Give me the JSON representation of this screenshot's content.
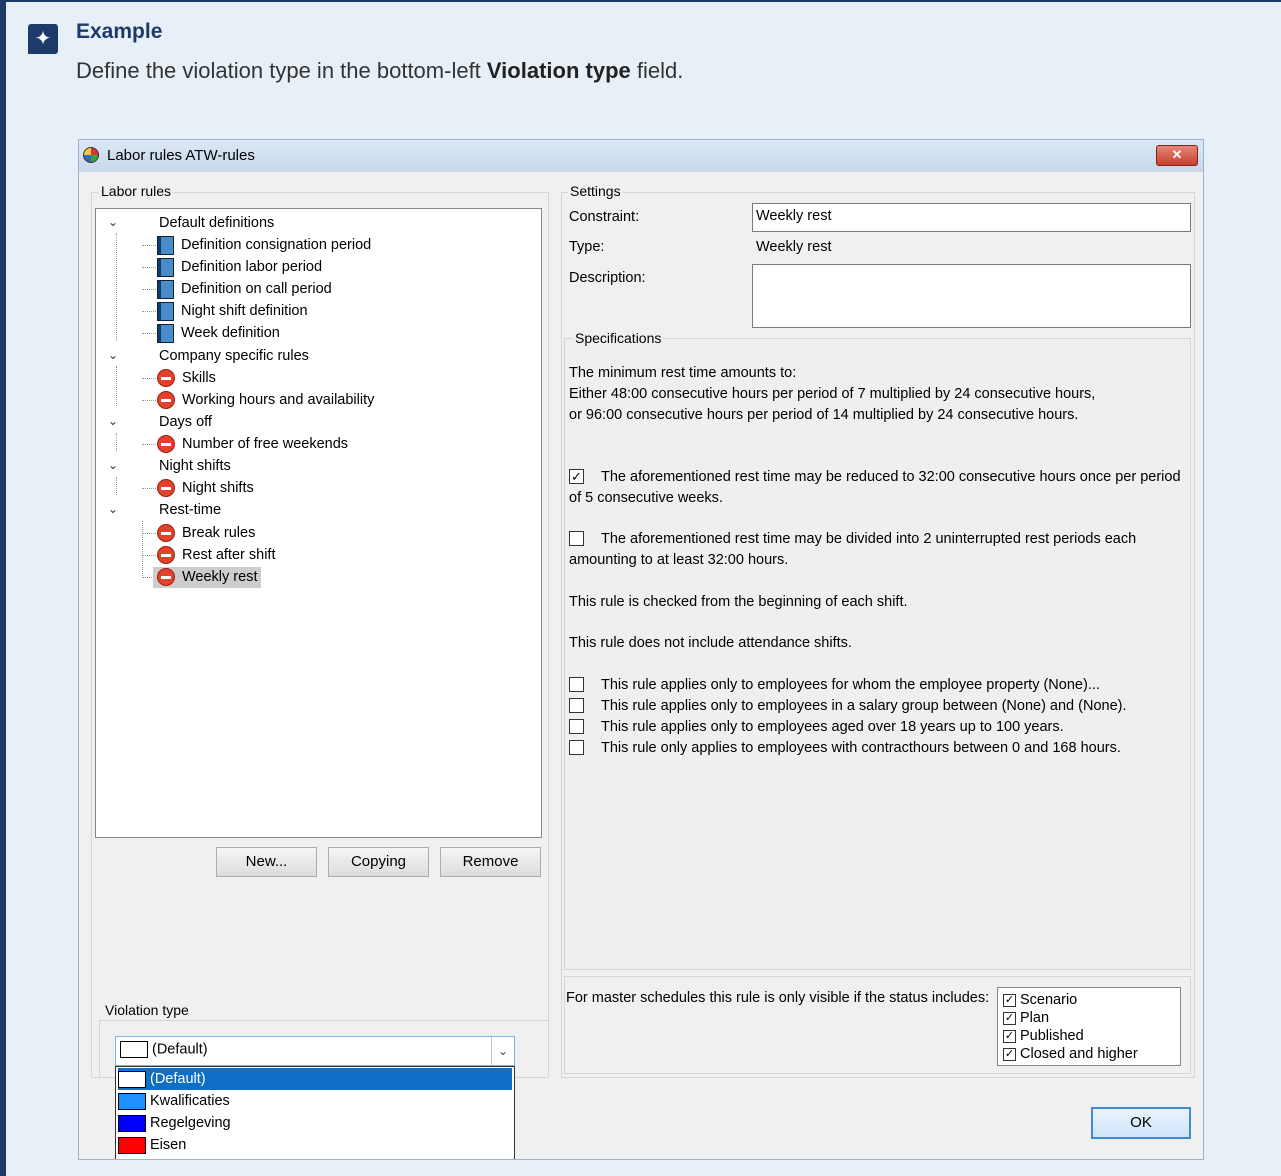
{
  "callout": {
    "icon": "sparkle-icon",
    "title": "Example",
    "body_prefix": "Define the violation type in the bottom-left ",
    "body_bold": "Violation type",
    "body_suffix": " field."
  },
  "dialog": {
    "title": "Labor rules ATW-rules",
    "close": "✕",
    "labor_rules_label": "Labor rules",
    "tree": {
      "group_default": "Default definitions",
      "default_items": [
        "Definition consignation period",
        "Definition labor period",
        "Definition on call period",
        "Night shift definition",
        "Week definition"
      ],
      "group_company": "Company specific rules",
      "company_items": [
        "Skills",
        "Working hours and availability"
      ],
      "group_daysoff": "Days off",
      "daysoff_items": [
        "Number of free weekends"
      ],
      "group_night": "Night shifts",
      "night_items": [
        "Night shifts"
      ],
      "group_rest": "Rest-time",
      "rest_items": [
        "Break rules",
        "Rest after shift",
        "Weekly rest"
      ]
    },
    "buttons": {
      "new": "New...",
      "copying": "Copying",
      "remove": "Remove",
      "ok": "OK"
    },
    "settings": {
      "label": "Settings",
      "constraint_label": "Constraint:",
      "constraint_value": "Weekly rest",
      "type_label": "Type:",
      "type_value": "Weekly rest",
      "description_label": "Description:",
      "description_value": ""
    },
    "specifications": {
      "label": "Specifications",
      "line1": "The minimum rest time amounts to:",
      "line2": "Either 48:00 consecutive hours per period of 7 multiplied by 24 consecutive hours,",
      "line3": "or 96:00 consecutive hours per period of 14 multiplied by 24 consecutive hours.",
      "reduce_a": "The aforementioned rest time may be reduced to 32:00 consecutive hours once per period",
      "reduce_b": "of 5 consecutive weeks.",
      "divide_a": "The aforementioned rest time may be divided into 2 uninterrupted rest periods each",
      "divide_b": "amounting to at least 32:00 hours.",
      "checked_from": "This rule is checked from the beginning of each shift.",
      "attendance": "This rule does not include attendance shifts.",
      "applies1": "This rule applies only to employees for whom the employee property (None)...",
      "applies2": "This rule applies only to employees in a salary group between (None) and (None).",
      "applies3": "This rule applies only to employees aged over 18 years up to 100 years.",
      "applies4": "This rule only applies to employees with contracthours between 0 and 168 hours."
    },
    "master": {
      "text": "For master schedules this rule is only visible if the status includes:",
      "statuses": [
        "Scenario",
        "Plan",
        "Published",
        "Closed and higher"
      ]
    },
    "violation": {
      "label": "Violation type",
      "selected": "(Default)",
      "options": [
        {
          "label": "(Default)",
          "color": "#ffffff"
        },
        {
          "label": "Kwalificaties",
          "color": "#1e90ff"
        },
        {
          "label": "Regelgeving",
          "color": "#0000ff"
        },
        {
          "label": "Eisen",
          "color": "#ff0000"
        }
      ]
    }
  }
}
